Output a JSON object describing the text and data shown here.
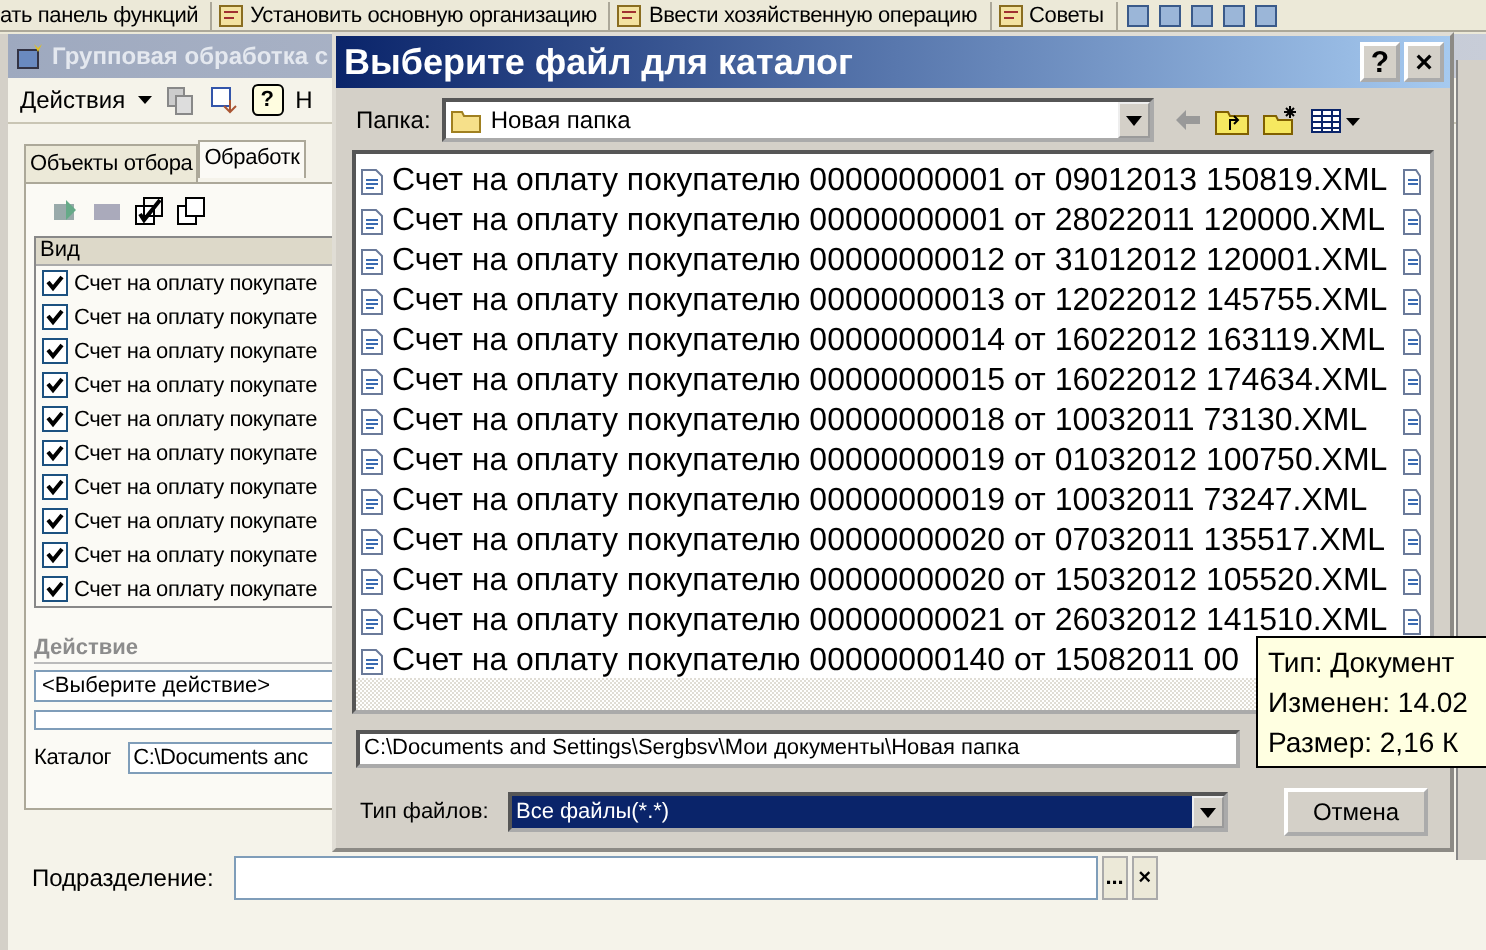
{
  "top_toolbar": {
    "items": [
      "ать панель функций",
      "Установить основную организацию",
      "Ввести хозяйственную операцию",
      "Советы"
    ]
  },
  "background_window": {
    "title": "Групповая обработка с",
    "toolbar": {
      "actions_menu": "Действия",
      "help": "?",
      "cut_label": "Н"
    },
    "tabs": [
      {
        "label": "Объекты отбора",
        "selected": false
      },
      {
        "label": "Обработк",
        "selected": true
      }
    ],
    "table": {
      "columns": [
        "Вид"
      ],
      "rows": [
        {
          "text": "Счет на оплату покупате",
          "checked": true
        },
        {
          "text": "Счет на оплату покупате",
          "checked": true
        },
        {
          "text": "Счет на оплату покупате",
          "checked": true
        },
        {
          "text": "Счет на оплату покупате",
          "checked": true
        },
        {
          "text": "Счет на оплату покупате",
          "checked": true
        },
        {
          "text": "Счет на оплату покупате",
          "checked": true
        },
        {
          "text": "Счет на оплату покупате",
          "checked": true
        },
        {
          "text": "Счет на оплату покупате",
          "checked": true
        },
        {
          "text": "Счет на оплату покупате",
          "checked": true
        },
        {
          "text": "Счет на оплату покупате",
          "checked": true
        }
      ]
    },
    "action_section": {
      "heading": "Действие",
      "select_value": "<Выберите действие>",
      "progress": {
        "level": 0
      },
      "catalog_label": "Каталог",
      "catalog_value": "C:\\Documents anc"
    },
    "department": {
      "label": "Подразделение:",
      "choose_button": "...",
      "clear_button": "×"
    }
  },
  "dialog": {
    "title": "Выберите файл для каталог",
    "help_button": "?",
    "close_button": "×",
    "folder_label": "Папка:",
    "folder_value": "Новая папка",
    "files": [
      "Счет на оплату покупателю 00000000001 от 09012013 150819.XML",
      "Счет на оплату покупателю 00000000001 от 28022011 120000.XML",
      "Счет на оплату покупателю 00000000012 от 31012012 120001.XML",
      "Счет на оплату покупателю 00000000013 от 12022012 145755.XML",
      "Счет на оплату покупателю 00000000014 от 16022012 163119.XML",
      "Счет на оплату покупателю 00000000015 от 16022012 174634.XML",
      "Счет на оплату покупателю 00000000018 от 10032011 73130.XML",
      "Счет на оплату покупателю 00000000019 от 01032012 100750.XML",
      "Счет на оплату покупателю 00000000019 от 10032011 73247.XML",
      "Счет на оплату покупателю 00000000020 от 07032011 135517.XML",
      "Счет на оплату покупателю 00000000020 от 15032012 105520.XML",
      "Счет на оплату покупателю 00000000021 от 26032012 141510.XML",
      "Счет на оплату покупателю 00000000140 от 15082011 00"
    ],
    "path_value": "C:\\Documents and Settings\\Sergbsv\\Мои документы\\Новая папка",
    "filetype_label": "Тип файлов:",
    "filetype": {
      "value": "Все файлы(*.*)",
      "highlighted": true
    },
    "cancel_button": "Отмена"
  },
  "tooltip": {
    "lines": [
      "Тип: Документ",
      "Изменен: 14.02",
      "Размер: 2,16 К"
    ]
  }
}
